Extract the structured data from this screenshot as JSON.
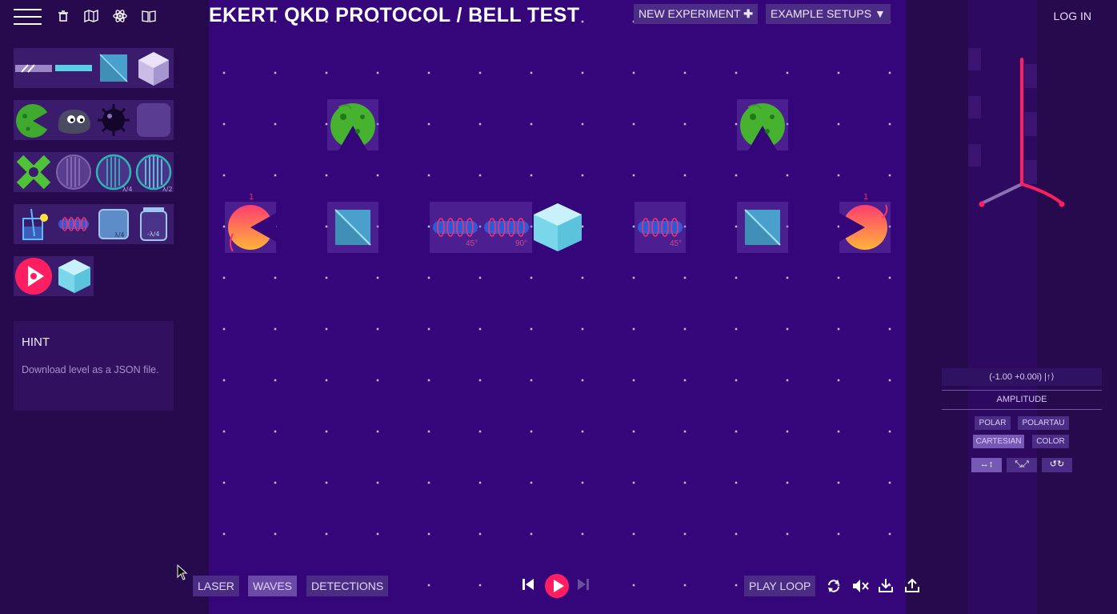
{
  "app": {
    "title": "EKERT QKD PROTOCOL / BELL TEST",
    "login": "LOG IN"
  },
  "toolbar": {
    "new_experiment": "NEW EXPERIMENT",
    "example_setups": "EXAMPLE SETUPS",
    "plus_icon": "plus-icon",
    "dropdown_icon": "triangle-down-icon"
  },
  "hint": {
    "heading": "HINT",
    "text": "Download level as a JSON file."
  },
  "bottom": {
    "laser": "LASER",
    "waves": "WAVES",
    "detections": "DETECTIONS",
    "play_loop": "PLAY LOOP"
  },
  "side": {
    "amplitude_value": "(-1.00 +0.00i) |↑⟩",
    "amplitude_label": "AMPLITUDE",
    "polar": "POLAR",
    "polartau": "POLARTAU",
    "cartesian": "CARTESIAN",
    "color": "COLOR"
  },
  "board": {
    "labels": {
      "phase_a": "45°",
      "phase_b": "90°",
      "phase_c": "45°",
      "det_a": "1",
      "det_b": "1"
    }
  },
  "tray_labels": {
    "lambda4": "λ/4",
    "lambda2": "λ/2",
    "plate_l4": "λ/4",
    "plate_ml4": "-λ/4"
  },
  "colors": {
    "accent": "#ff1e62",
    "bg": "#270a4d",
    "stage": "#35067a"
  }
}
